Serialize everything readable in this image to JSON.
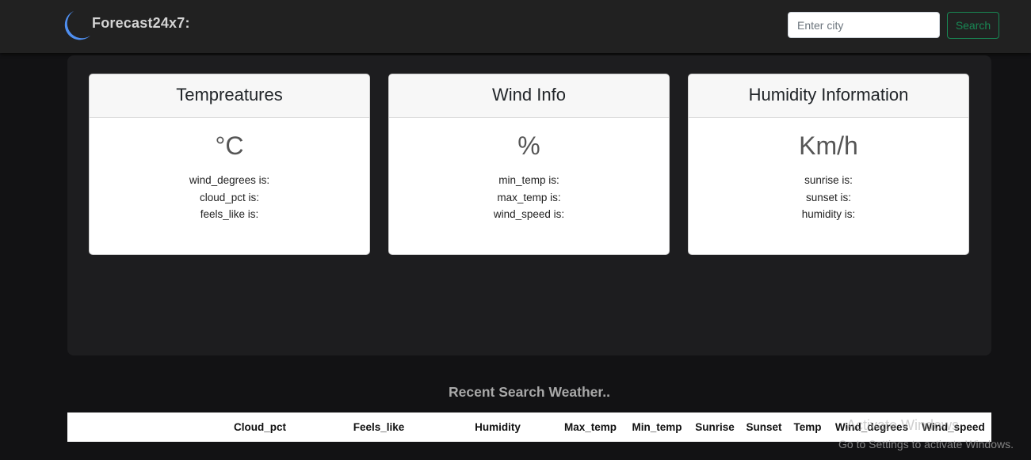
{
  "navbar": {
    "brand_name": "Forecast24x7:",
    "logo_icon": "crescent-moon-icon",
    "search": {
      "placeholder": "Enter city",
      "value": "",
      "button_label": "Search"
    }
  },
  "cards": [
    {
      "title": "Tempreatures",
      "unit": "°C",
      "lines": [
        "wind_degrees is:",
        "cloud_pct is:",
        "feels_like is:"
      ]
    },
    {
      "title": "Wind Info",
      "unit": "%",
      "lines": [
        "min_temp is:",
        "max_temp is:",
        "wind_speed is:"
      ]
    },
    {
      "title": "Humidity Information",
      "unit": "Km/h",
      "lines": [
        "sunrise is:",
        "sunset is:",
        "humidity is:"
      ]
    }
  ],
  "recent": {
    "title": "Recent Search Weather..",
    "columns": [
      "Cloud_pct",
      "Feels_like",
      "Humidity",
      "Max_temp",
      "Min_temp",
      "Sunrise",
      "Sunset",
      "Temp",
      "Wind_degrees",
      "Wind_speed"
    ]
  },
  "watermark": {
    "line1": "Activate Windows",
    "line2": "Go to Settings to activate Windows."
  },
  "colors": {
    "navbar": "#212121",
    "background": "#121214",
    "panel": "#1d1d1f",
    "accent_green": "#198754",
    "logo_blue": "#4f8ff0"
  }
}
